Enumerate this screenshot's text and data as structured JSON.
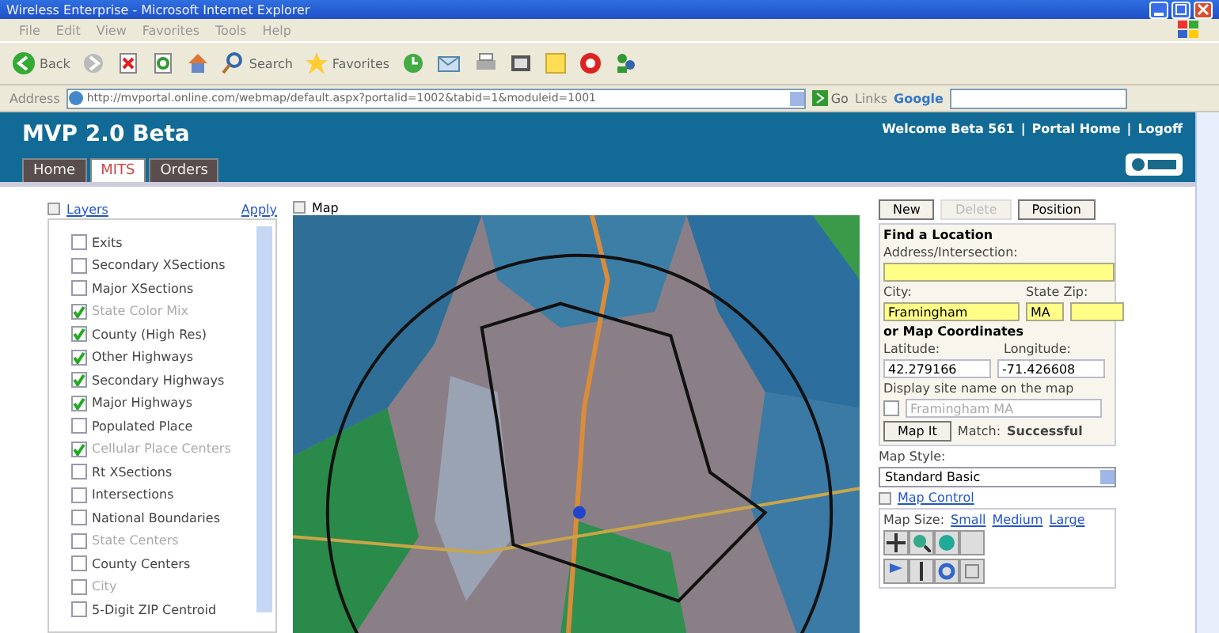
{
  "window": {
    "title": "Wireless Enterprise - Microsoft Internet Explorer"
  },
  "menu": [
    "File",
    "Edit",
    "View",
    "Favorites",
    "Tools",
    "Help"
  ],
  "toolbar": {
    "back": "Back",
    "search": "Search",
    "favorites": "Favorites"
  },
  "address_bar": {
    "label": "Address",
    "url": "http://mvportal.online.com/webmap/default.aspx?portalid=1002&tabid=1&moduleid=1001",
    "go": "Go",
    "links": "Links",
    "google": "Google"
  },
  "header": {
    "title": "MVP 2.0 Beta",
    "welcome": "Welcome Beta 561",
    "separator": "|",
    "links": [
      "Portal Home",
      "Logoff"
    ]
  },
  "tabs": [
    {
      "label": "Home",
      "selected": false
    },
    {
      "label": "MITS",
      "selected": true
    },
    {
      "label": "Orders",
      "selected": false
    }
  ],
  "layers": {
    "title": "Layers",
    "apply": "Apply",
    "items": [
      {
        "label": "Exits",
        "checked": false,
        "disabled": false
      },
      {
        "label": "Secondary XSections",
        "checked": false,
        "disabled": false
      },
      {
        "label": "Major XSections",
        "checked": false,
        "disabled": false
      },
      {
        "label": "State Color Mix",
        "checked": true,
        "disabled": true
      },
      {
        "label": "County (High Res)",
        "checked": true,
        "disabled": false
      },
      {
        "label": "Other Highways",
        "checked": true,
        "disabled": false
      },
      {
        "label": "Secondary Highways",
        "checked": true,
        "disabled": false
      },
      {
        "label": "Major Highways",
        "checked": true,
        "disabled": false
      },
      {
        "label": "Populated Place",
        "checked": false,
        "disabled": false
      },
      {
        "label": "Cellular Place Centers",
        "checked": true,
        "disabled": true
      },
      {
        "label": "Rt XSections",
        "checked": false,
        "disabled": false
      },
      {
        "label": "Intersections",
        "checked": false,
        "disabled": false
      },
      {
        "label": "National Boundaries",
        "checked": false,
        "disabled": false
      },
      {
        "label": "State Centers",
        "checked": false,
        "disabled": true
      },
      {
        "label": "County Centers",
        "checked": false,
        "disabled": false
      },
      {
        "label": "City",
        "checked": false,
        "disabled": true
      },
      {
        "label": "5-Digit ZIP Centroid",
        "checked": false,
        "disabled": false
      }
    ]
  },
  "map": {
    "label": "Map"
  },
  "actions": [
    {
      "label": "New",
      "disabled": false
    },
    {
      "label": "Delete",
      "disabled": true
    },
    {
      "label": "Position",
      "disabled": false
    }
  ],
  "find": {
    "title": "Find a Location",
    "address_label": "Address/Intersection:",
    "city_label": "City:",
    "city": "Framingham",
    "state_label": "State Zip:",
    "state": "MA",
    "coords_title": "or Map Coordinates",
    "lat_label": "Latitude:",
    "latitude": "42.279166",
    "lon_label": "Longitude:",
    "longitude": "-71.426608",
    "display_label": "Display site name on the map",
    "display_checked": false,
    "site_name": "Framingham MA",
    "map_it": "Map It",
    "match_label": "Match:",
    "match": "Successful"
  },
  "map_style": {
    "label": "Map Style:",
    "value": "Standard Basic"
  },
  "map_control": {
    "title": "Map Control",
    "size_label": "Map Size:",
    "sizes": [
      "Small",
      "Medium",
      "Large"
    ]
  }
}
